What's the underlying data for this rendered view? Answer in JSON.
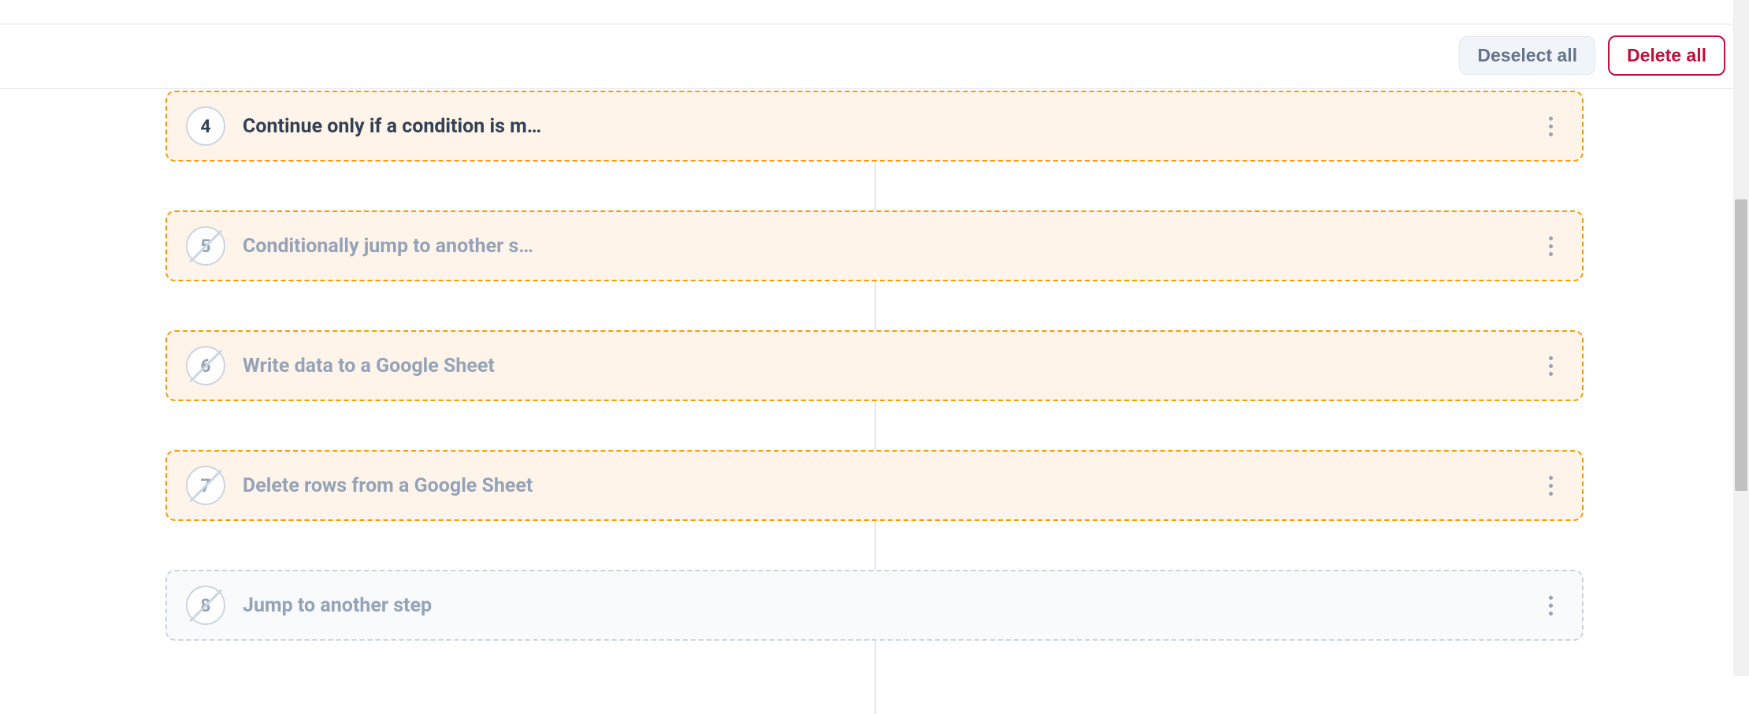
{
  "toolbar": {
    "deselect_label": "Deselect all",
    "delete_label": "Delete all"
  },
  "steps": [
    {
      "number": "4",
      "title": "Continue only if a condition is m…",
      "selected": true,
      "disabled": false
    },
    {
      "number": "5",
      "title": "Conditionally jump to another s…",
      "selected": true,
      "disabled": true
    },
    {
      "number": "6",
      "title": "Write data to a Google Sheet",
      "selected": true,
      "disabled": true
    },
    {
      "number": "7",
      "title": "Delete rows from a Google Sheet",
      "selected": true,
      "disabled": true
    },
    {
      "number": "8",
      "title": "Jump to another step",
      "selected": false,
      "disabled": true
    }
  ]
}
